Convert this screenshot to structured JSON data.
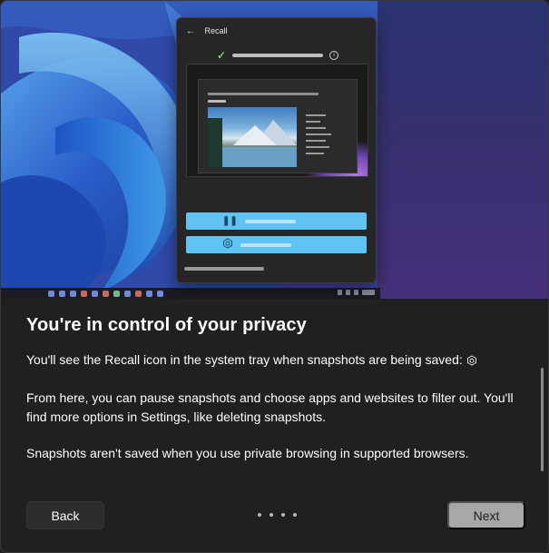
{
  "hero": {
    "recall_window": {
      "title": "Recall"
    }
  },
  "content": {
    "title": "You're in control of your privacy",
    "tray_line": "You'll see the Recall icon in the system tray when snapshots are being saved:",
    "paragraph_2": "From here, you can pause snapshots and choose apps and websites to filter out. You'll find more options in Settings, like deleting snapshots.",
    "paragraph_3": "Snapshots aren't saved when you use private browsing in supported browsers."
  },
  "footer": {
    "back_label": "Back",
    "next_label": "Next",
    "page_indicator": {
      "total": 4
    }
  },
  "colors": {
    "dialog_bg": "#202020",
    "accent_action": "#5fc4f3",
    "next_button": "#a7a7a7",
    "back_button": "#2d2d2d"
  },
  "icons": [
    "back-arrow-icon",
    "checkmark-icon",
    "info-icon",
    "pause-icon",
    "recall-icon"
  ]
}
